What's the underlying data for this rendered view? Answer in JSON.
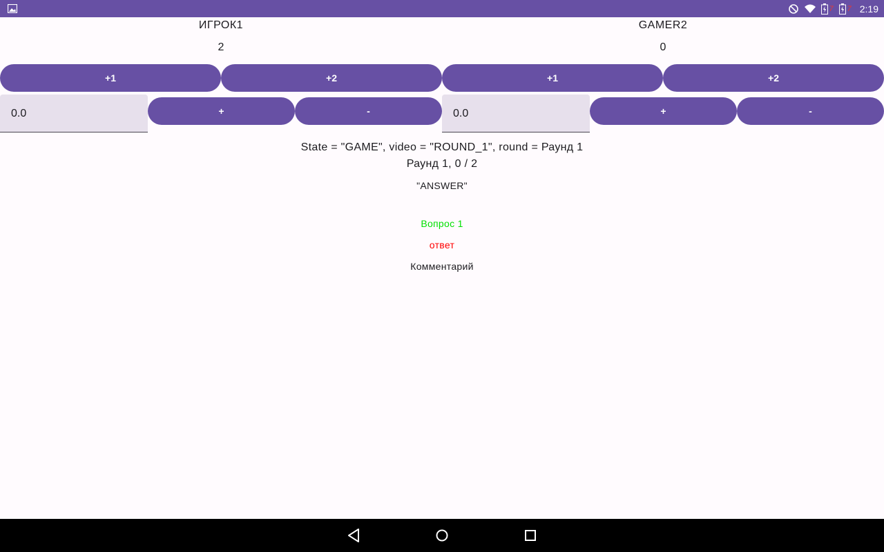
{
  "status_bar": {
    "left_icon": "image-notification-icon",
    "battery1_level": "7",
    "battery2_level": "7",
    "time": "2:19"
  },
  "players": [
    {
      "name": "ИГРОК1",
      "score": "2",
      "plus1_label": "+1",
      "plus2_label": "+2",
      "field_value": "0.0",
      "add_label": "+",
      "sub_label": "-"
    },
    {
      "name": "GAMER2",
      "score": "0",
      "plus1_label": "+1",
      "plus2_label": "+2",
      "field_value": "0.0",
      "add_label": "+",
      "sub_label": "-"
    }
  ],
  "info": {
    "state_line": "State = \"GAME\", video = \"ROUND_1\", round = Раунд 1",
    "round_line": "Раунд 1, 0 / 2",
    "answer_type": "\"ANSWER\"",
    "question": "Вопрос 1",
    "answer": "ответ",
    "comment": "Комментарий"
  },
  "colors": {
    "primary": "#6750a4",
    "question": "#00e000",
    "answer": "#ff0000",
    "field_bg": "#e7e0ec"
  },
  "nav": {
    "back": "back-icon",
    "home": "home-icon",
    "recents": "recents-icon"
  }
}
